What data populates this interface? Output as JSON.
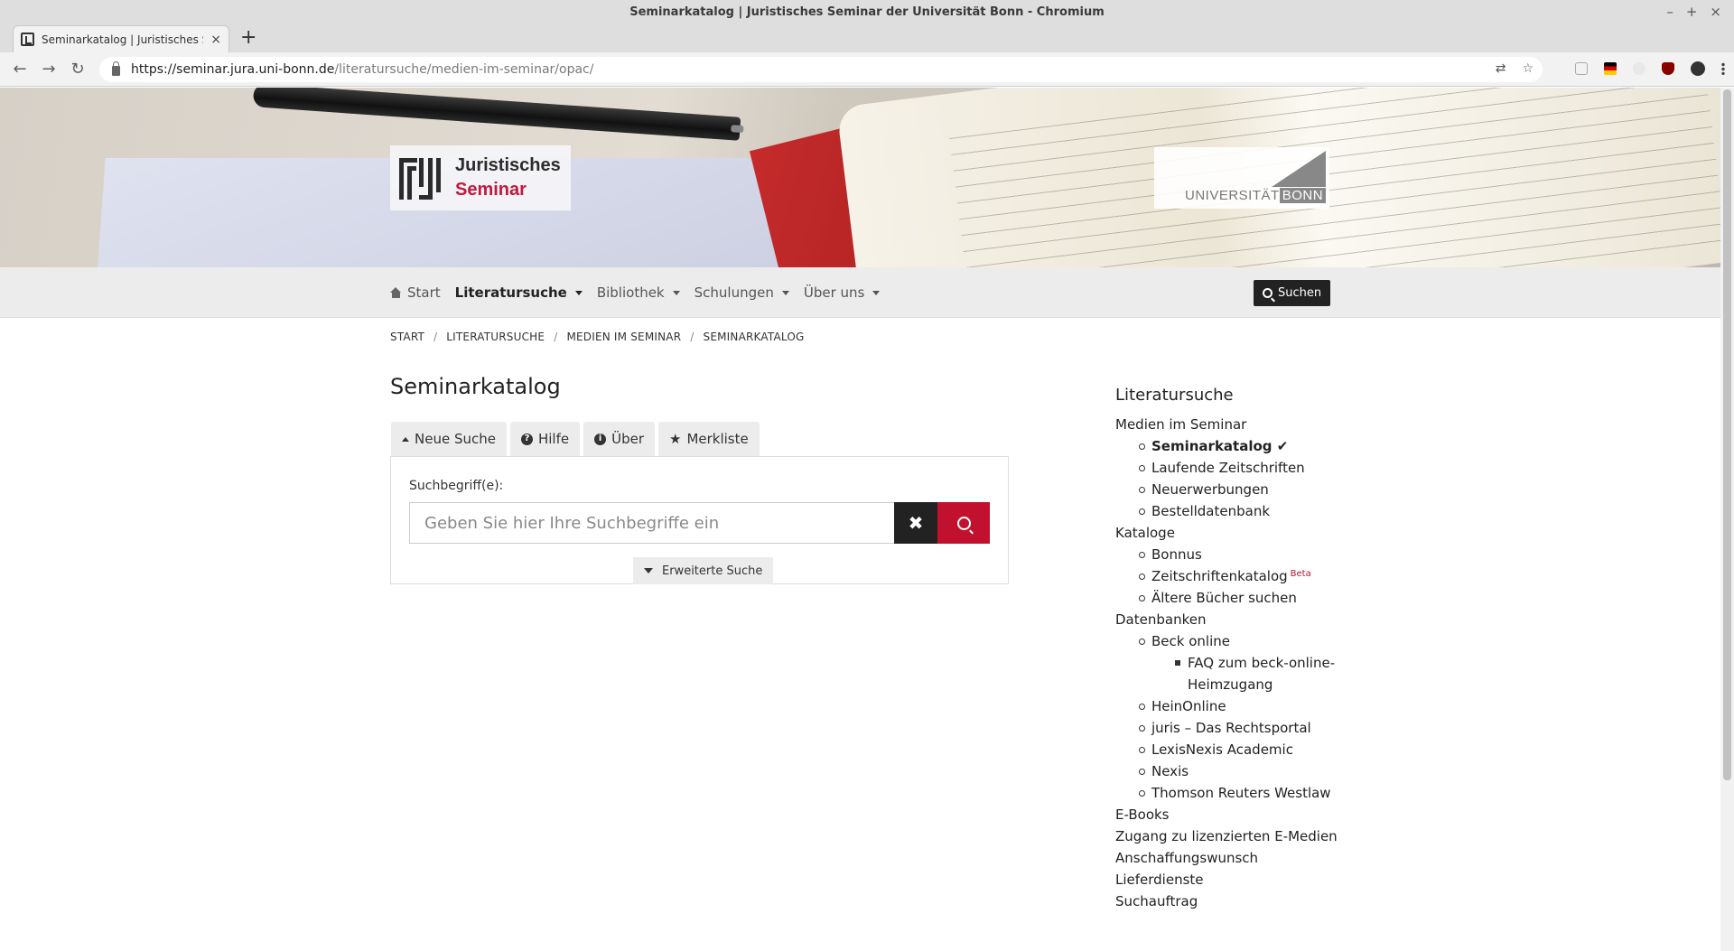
{
  "window": {
    "title": "Seminarkatalog | Juristisches Seminar der Universität Bonn - Chromium",
    "controls": [
      "–",
      "+",
      "×"
    ]
  },
  "tab": {
    "title": "Seminarkatalog | Juristisches S",
    "close": "×",
    "new": "+"
  },
  "toolbar": {
    "back": "←",
    "forward": "→",
    "reload": "↻",
    "url_host": "https://seminar.jura.uni-bonn.de",
    "url_path": "/literatursuche/medien-im-seminar/opac/",
    "translate": "⇄",
    "bookmark": "☆"
  },
  "header": {
    "logo_line1": "Juristisches",
    "logo_line2": "Seminar",
    "uni_text": "UNIVERSITÄT",
    "uni_bonn": "BONN"
  },
  "nav": {
    "items": [
      {
        "label": "Start"
      },
      {
        "label": "Literatursuche"
      },
      {
        "label": "Bibliothek"
      },
      {
        "label": "Schulungen"
      },
      {
        "label": "Über uns"
      }
    ],
    "search_label": "Suchen"
  },
  "breadcrumb": [
    "START",
    "LITERATURSUCHE",
    "MEDIEN IM SEMINAR",
    "SEMINARKATALOG"
  ],
  "breadcrumb_sep": "/",
  "main": {
    "title": "Seminarkatalog",
    "tabs": [
      {
        "label": "Neue Suche"
      },
      {
        "label": "Hilfe",
        "icon": "?"
      },
      {
        "label": "Über",
        "icon": "i"
      },
      {
        "label": "Merkliste",
        "icon": "★"
      }
    ],
    "search": {
      "label": "Suchbegriff(e):",
      "placeholder": "Geben Sie hier Ihre Suchbegriffe ein",
      "value": "",
      "clear": "✖",
      "advanced": "Erweiterte Suche"
    }
  },
  "sidebar": {
    "title": "Literatursuche",
    "section1": "Medien im Seminar",
    "section1_items": [
      "Seminarkatalog",
      "Laufende Zeitschriften",
      "Neuerwerbungen",
      "Bestelldatenbank"
    ],
    "current_mark": "✔",
    "section2": "Kataloge",
    "section2_items": [
      "Bonnus",
      "Zeitschriftenkatalog",
      "Ältere Bücher suchen"
    ],
    "beta": "Beta",
    "section3": "Datenbanken",
    "beck": "Beck online",
    "beck_faq": "FAQ zum beck-online-Heimzugang",
    "section3_items": [
      "HeinOnline",
      "juris – Das Rechtsportal",
      "LexisNexis Academic",
      "Nexis",
      "Thomson Reuters Westlaw"
    ],
    "bottom_items": [
      "E-Books",
      "Zugang zu lizenzierten E-Medien",
      "Anschaffungswunsch",
      "Lieferdienste",
      "Suchauftrag"
    ]
  },
  "colors": {
    "accent": "#c1112f",
    "dark": "#222222",
    "nav_bg": "#ececec"
  }
}
